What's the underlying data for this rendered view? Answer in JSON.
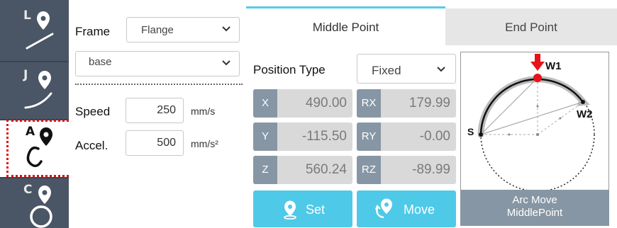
{
  "motion_types": [
    {
      "letter": "L",
      "icon": "linear-move-icon"
    },
    {
      "letter": "J",
      "icon": "joint-move-icon"
    },
    {
      "letter": "A",
      "icon": "arc-move-icon",
      "selected": true
    },
    {
      "letter": "C",
      "icon": "circle-move-icon"
    }
  ],
  "settings": {
    "frame_label": "Frame",
    "frame_value": "Flange",
    "base_value": "base",
    "speed_label": "Speed",
    "speed_value": "250",
    "speed_unit": "mm/s",
    "accel_label": "Accel.",
    "accel_value": "500",
    "accel_unit": "mm/s²"
  },
  "tabs": {
    "active": "Middle Point",
    "inactive": "End Point"
  },
  "position": {
    "type_label": "Position Type",
    "type_value": "Fixed",
    "x_label": "X",
    "x": "490.00",
    "y_label": "Y",
    "y": "-115.50",
    "z_label": "Z",
    "z": "560.24",
    "rx_label": "RX",
    "rx": "179.99",
    "ry_label": "RY",
    "ry": "-0.00",
    "rz_label": "RZ",
    "rz": "-89.99"
  },
  "actions": {
    "set_label": "Set",
    "move_label": "Move"
  },
  "diagram": {
    "label_w1": "W1",
    "label_w2": "W2",
    "label_s": "S",
    "caption_line1": "Arc Move",
    "caption_line2": "MiddlePoint"
  },
  "colors": {
    "rail": "#4a5565",
    "accent": "#4fc9e8",
    "axis_badge": "#8796a4",
    "highlight": "#e01010",
    "marker": "#e8121b"
  }
}
